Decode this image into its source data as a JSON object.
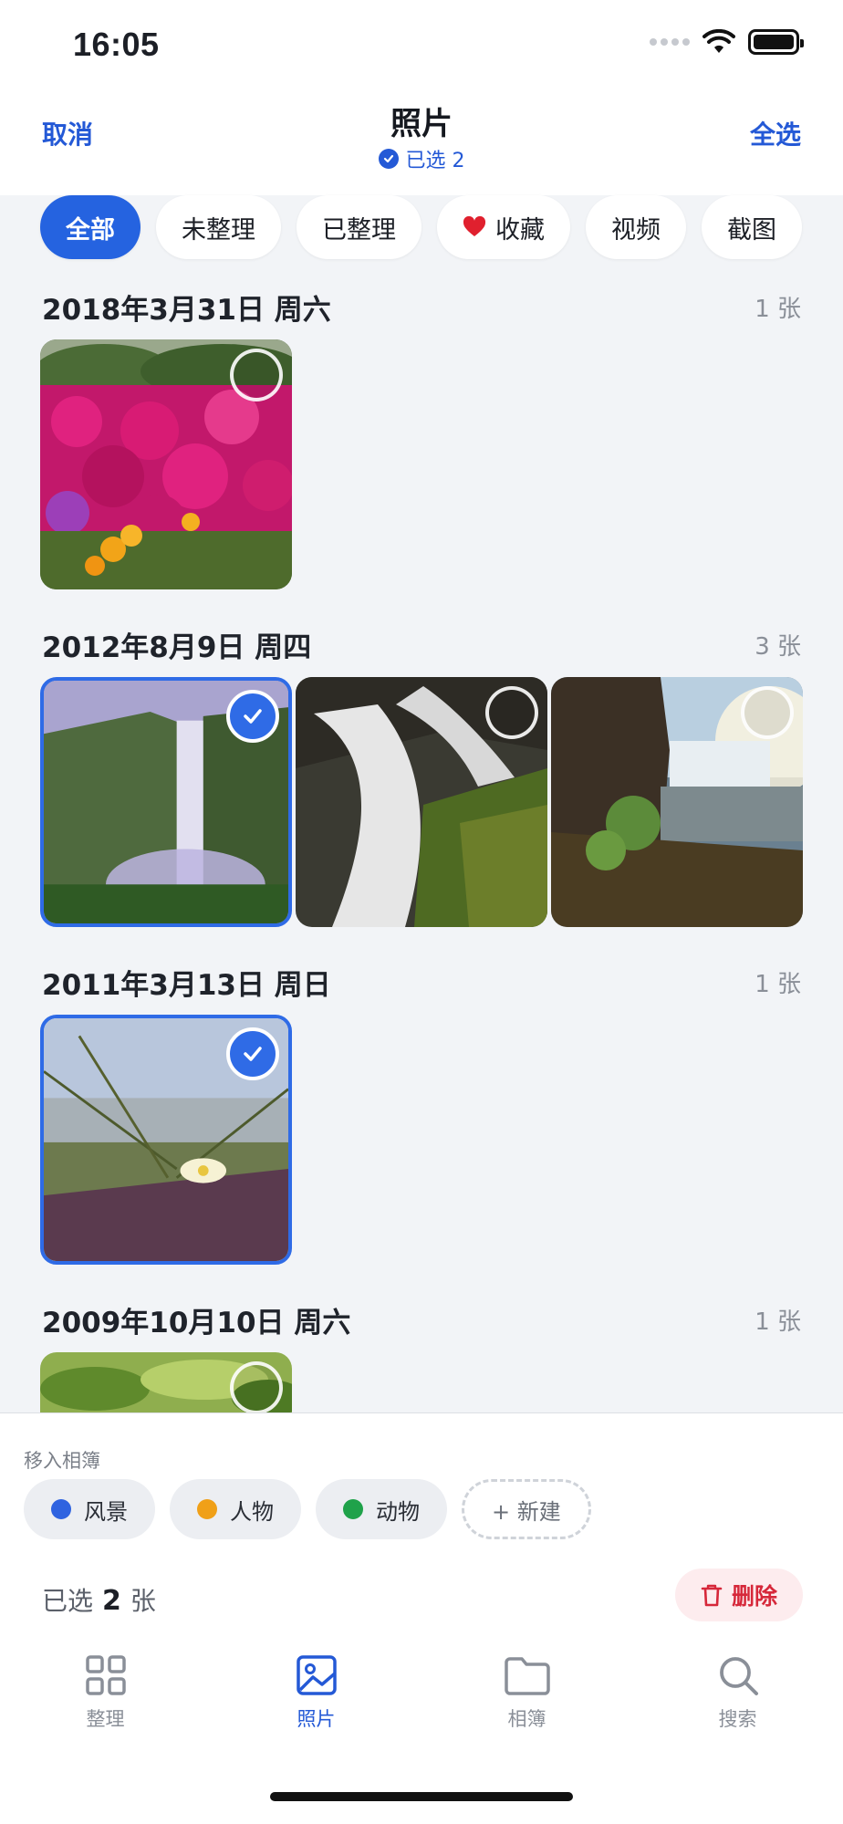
{
  "status": {
    "time": "16:05",
    "signal_icon": "signal-dots-icon",
    "wifi_icon": "wifi-icon",
    "battery_icon": "battery-icon"
  },
  "nav": {
    "cancel": "取消",
    "title": "照片",
    "selected_text": "已选 2",
    "select_all": "全选"
  },
  "filters": [
    {
      "label": "全部",
      "active": true
    },
    {
      "label": "未整理",
      "active": false
    },
    {
      "label": "已整理",
      "active": false
    },
    {
      "label": "收藏",
      "active": false,
      "icon": "heart-icon",
      "icon_color": "#e0202e"
    },
    {
      "label": "视频",
      "active": false
    },
    {
      "label": "截图",
      "active": false
    }
  ],
  "sections": [
    {
      "date": "2018年3月31日 周六",
      "count": "1 张",
      "photos": [
        {
          "scene": "pink-flowers",
          "selected": false
        }
      ]
    },
    {
      "date": "2012年8月9日 周四",
      "count": "3 张",
      "photos": [
        {
          "scene": "waterfall-cliff",
          "selected": true
        },
        {
          "scene": "waterfall-closeup",
          "selected": false
        },
        {
          "scene": "waterfall-sunset",
          "selected": false
        }
      ]
    },
    {
      "date": "2011年3月13日 周日",
      "count": "1 张",
      "photos": [
        {
          "scene": "flower-grass",
          "selected": true
        }
      ]
    },
    {
      "date": "2009年10月10日 周六",
      "count": "1 张",
      "photos": [
        {
          "scene": "green-leaves",
          "selected": false
        }
      ]
    }
  ],
  "bottom": {
    "move_label": "移入相簿",
    "albums": [
      {
        "label": "风景",
        "color": "#2f63e0"
      },
      {
        "label": "人物",
        "color": "#f0a018"
      },
      {
        "label": "动物",
        "color": "#1fa24a"
      }
    ],
    "new_album": "+ 新建",
    "selected_prefix": "已选",
    "selected_count": "2",
    "selected_suffix": "张",
    "delete_label": "删除"
  },
  "tabs": [
    {
      "label": "整理",
      "icon": "grid-icon",
      "active": false
    },
    {
      "label": "照片",
      "icon": "image-icon",
      "active": true
    },
    {
      "label": "相簿",
      "icon": "folder-icon",
      "active": false
    },
    {
      "label": "搜索",
      "icon": "search-icon",
      "active": false
    }
  ],
  "colors": {
    "accent": "#2459d6",
    "danger": "#d6283a",
    "background": "#f2f4f7"
  }
}
